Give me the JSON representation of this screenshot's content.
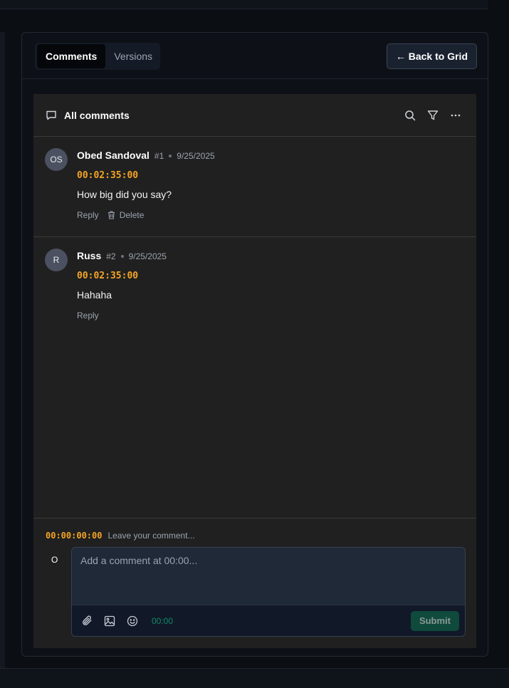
{
  "tabs": [
    {
      "label": "Comments",
      "active": true
    },
    {
      "label": "Versions",
      "active": false
    }
  ],
  "back_button": {
    "label": "← Back to Grid"
  },
  "comments_header": {
    "title": "All comments",
    "icons": [
      "search-icon",
      "filter-icon",
      "more-icon"
    ]
  },
  "comments": [
    {
      "initials": "OS",
      "author": "Obed Sandoval",
      "number": "#1",
      "date": "9/25/2025",
      "timecode": "00:02:35:00",
      "text": "How big did you say?",
      "actions": {
        "reply": "Reply",
        "delete": "Delete"
      }
    },
    {
      "initials": "R",
      "author": "Russ",
      "number": "#2",
      "date": "9/25/2025",
      "timecode": "00:02:35:00",
      "text": "Hahaha",
      "actions": {
        "reply": "Reply"
      }
    }
  ],
  "composer": {
    "timecode": "00:00:00:00",
    "hint": "Leave your comment...",
    "avatar_initial": "O",
    "placeholder": "Add a comment at 00:00...",
    "toolbar_time": "00:00",
    "submit_label": "Submit",
    "toolbar_icons": [
      "paperclip-icon",
      "image-icon",
      "emoji-icon"
    ]
  },
  "colors": {
    "timecode": "#f5a524",
    "accent_green": "#0f8a6c",
    "submit_bg": "#0f4a3d"
  }
}
